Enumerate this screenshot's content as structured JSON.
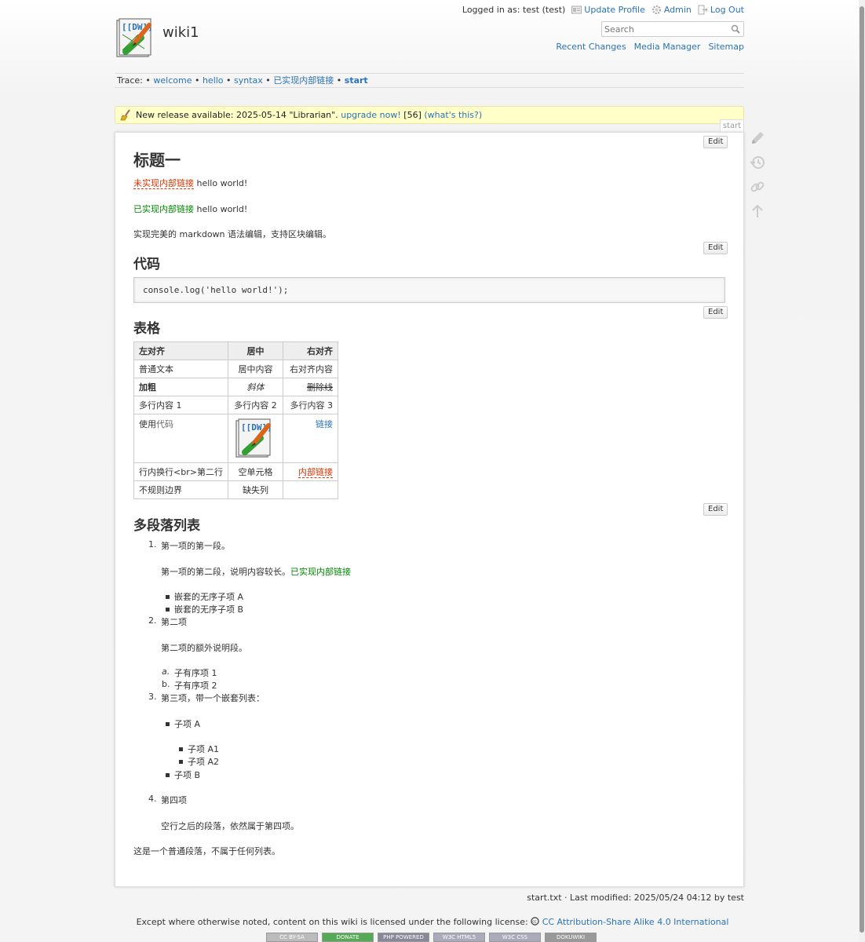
{
  "header": {
    "site_title": "wiki1",
    "logged_in": "Logged in as: test (test)",
    "user_tools": [
      "Update Profile",
      "Admin",
      "Log Out"
    ],
    "search_placeholder": "Search",
    "site_tools": [
      "Recent Changes",
      "Media Manager",
      "Sitemap"
    ]
  },
  "trace": {
    "label": "Trace:",
    "items": [
      "welcome",
      "hello",
      "syntax",
      "已实现内部链接"
    ],
    "current": "start"
  },
  "notice": {
    "text": "New release available: 2025-05-14 \"Librarian\".",
    "link": "upgrade now!",
    "count": "[56]",
    "whats": "(what's this?)"
  },
  "page_id": "start",
  "edit_label": "Edit",
  "content": {
    "h1": "标题一",
    "p1_link": "未实现内部链接",
    "p1_text": " hello world!",
    "p2_link": "已实现内部链接",
    "p2_text": " hello world!",
    "p3": "实现完美的 markdown 语法编辑，支持区块编辑。",
    "h_code": "代码",
    "code": "console.log('hello world!');",
    "h_table": "表格",
    "table": {
      "headers": [
        "左对齐",
        "居中",
        "右对齐"
      ],
      "r1": [
        "普通文本",
        "居中内容",
        "右对齐内容"
      ],
      "r2": [
        "加粗",
        "斜体",
        "删除线"
      ],
      "r3": [
        "多行内容 1",
        "多行内容 2",
        "多行内容 3"
      ],
      "r4_a": "使用",
      "r4_code": "代码",
      "r4_link": "链接",
      "r5": [
        "行内换行<br>第二行",
        "空单元格",
        "内部链接"
      ],
      "r6": [
        "不规则边界",
        "缺失列",
        ""
      ]
    },
    "h_list": "多段落列表",
    "list": {
      "n1": "1.",
      "i1": "第一项的第一段。",
      "i1_p2": "第一项的第二段，说明内容较长。",
      "i1_link": "已实现内部链接",
      "i1_sub_a": "嵌套的无序子项 A",
      "i1_sub_b": "嵌套的无序子项 B",
      "n2": "2.",
      "i2": "第二项",
      "i2_p2": "第二项的额外说明段。",
      "i2_a_mark": "a.",
      "i2_a": "子有序项 1",
      "i2_b_mark": "b.",
      "i2_b": "子有序项 2",
      "n3": "3.",
      "i3": "第三项，带一个嵌套列表：",
      "i3_a": "子项 A",
      "i3_a1": "子项 A1",
      "i3_a2": "子项 A2",
      "i3_b": "子项 B",
      "n4": "4.",
      "i4": "第四项",
      "i4_p2": "空行之后的段落，依然属于第四项。"
    },
    "final_p": "这是一个普通段落，不属于任何列表。"
  },
  "footer": {
    "meta": "start.txt · Last modified: 2025/05/24 04:12 by test",
    "license_text": "Except where otherwise noted, content on this wiki is licensed under the following license:",
    "license_link": "CC Attribution-Share Alike 4.0 International",
    "badges": [
      "CC BY-SA",
      "DONATE",
      "PHP POWERED",
      "W3C HTML5",
      "W3C CSS",
      "DOKUWIKI"
    ]
  },
  "colors": {
    "link": "#2b73b7",
    "broken_link": "#dd3300",
    "existing_link": "#008800",
    "notice_bg": "#ffffc8"
  }
}
